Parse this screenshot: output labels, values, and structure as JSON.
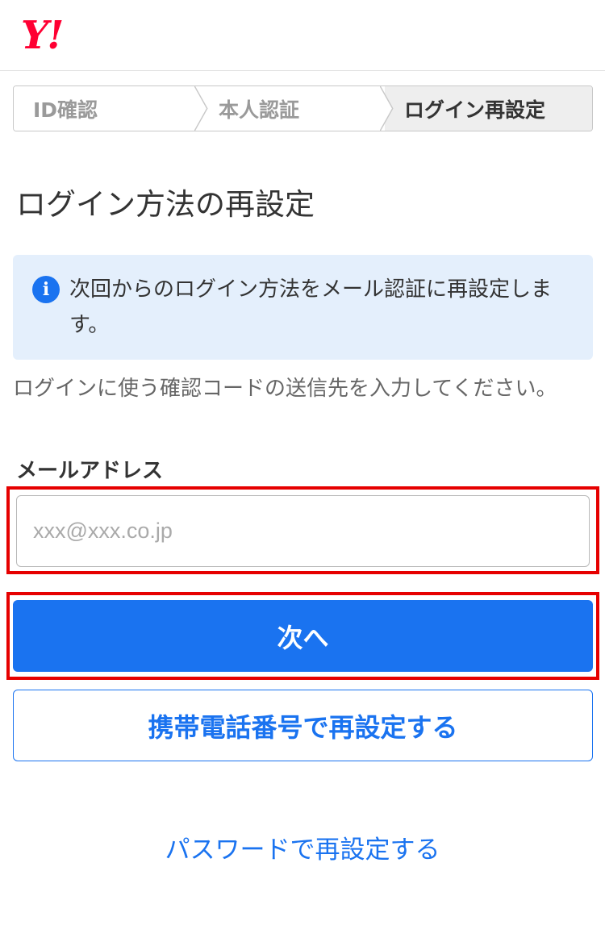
{
  "header": {
    "logo_text": "Y!"
  },
  "steps": [
    {
      "label": "ID確認"
    },
    {
      "label": "本人認証"
    },
    {
      "label": "ログイン再設定"
    }
  ],
  "page_title": "ログイン方法の再設定",
  "info": {
    "icon": "info-icon",
    "icon_glyph": "i",
    "text": "次回からのログイン方法をメール認証に再設定します。"
  },
  "instruction": "ログインに使う確認コードの送信先を入力してください。",
  "email_field": {
    "label": "メールアドレス",
    "placeholder": "xxx@xxx.co.jp",
    "value": ""
  },
  "buttons": {
    "next_label": "次へ",
    "phone_label": "携帯電話番号で再設定する"
  },
  "links": {
    "password_label": "パスワードで再設定する"
  },
  "colors": {
    "brand_red": "#ff0033",
    "accent_blue": "#1a73f0",
    "info_bg": "#e4effc",
    "highlight_red": "#e60000"
  }
}
